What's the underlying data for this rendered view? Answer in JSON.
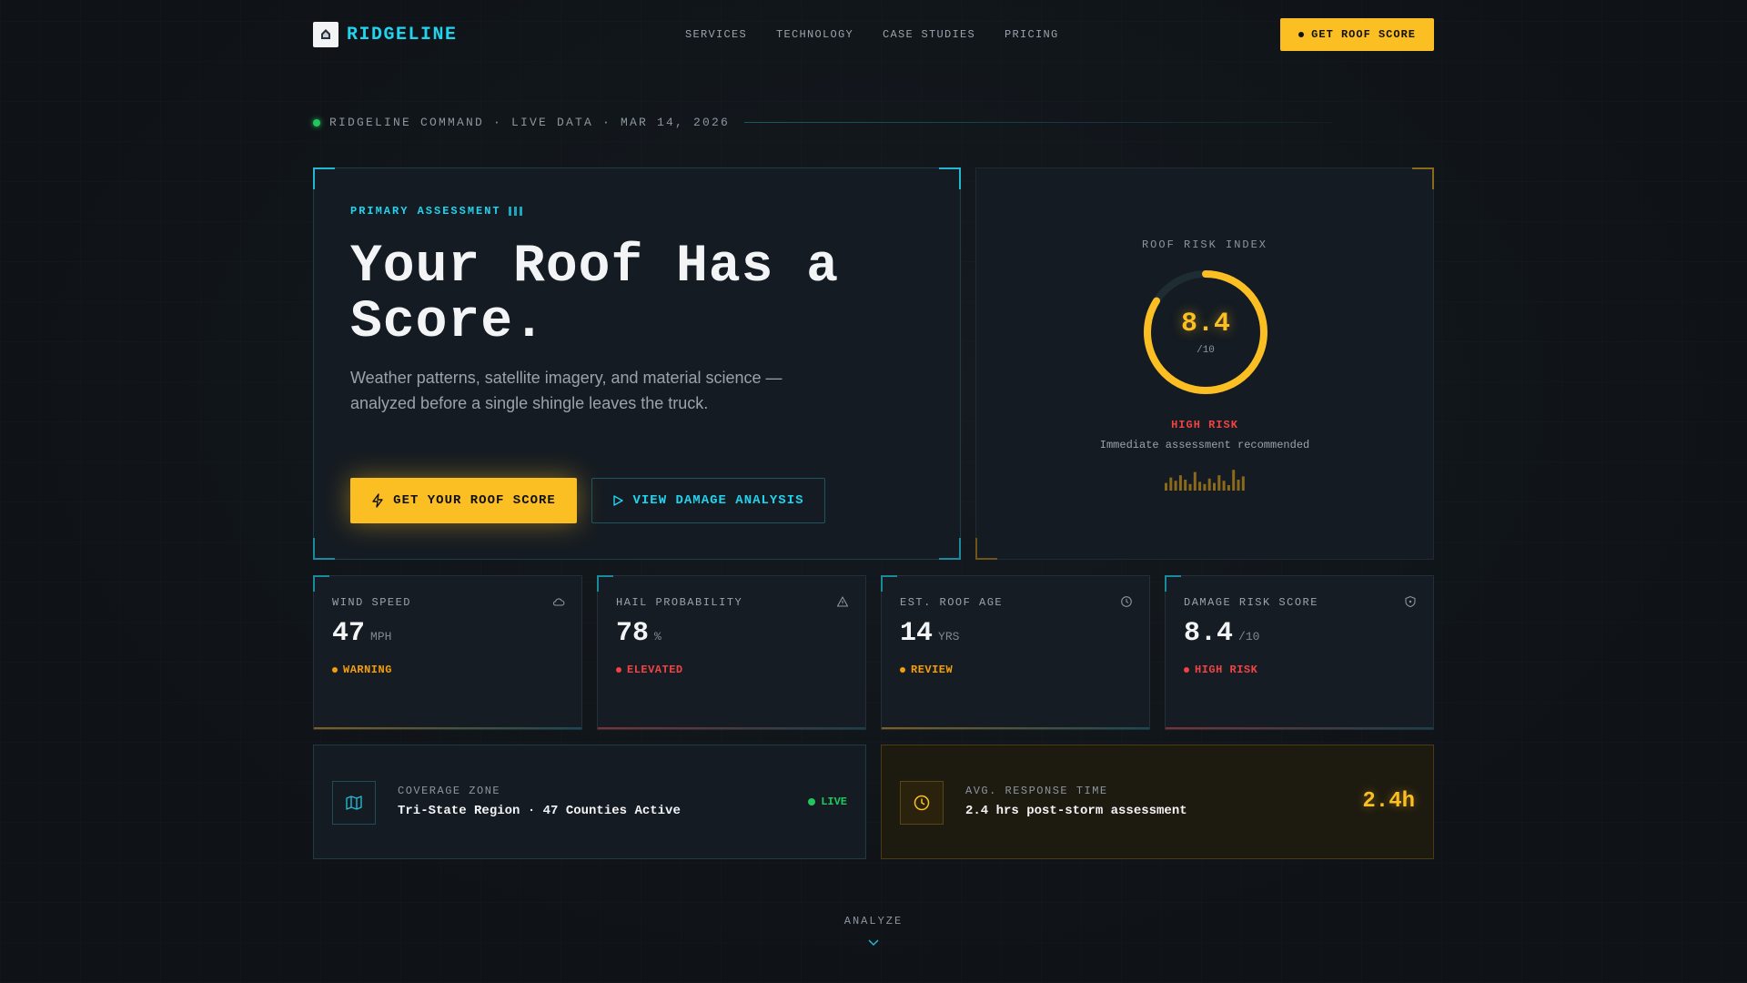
{
  "brand": {
    "name": "RIDGELINE"
  },
  "nav": {
    "links": [
      "SERVICES",
      "TECHNOLOGY",
      "CASE STUDIES",
      "PRICING"
    ],
    "cta": "GET ROOF SCORE"
  },
  "status_line": "RIDGELINE COMMAND · LIVE DATA · MAR 14, 2026",
  "hero": {
    "eyebrow": "PRIMARY ASSESSMENT",
    "headline": "Your Roof Has a Score.",
    "subcopy": "Weather patterns, satellite imagery, and material science — analyzed before a single shingle leaves the truck.",
    "primary_cta": "GET YOUR ROOF SCORE",
    "secondary_cta": "VIEW DAMAGE ANALYSIS"
  },
  "risk_index": {
    "label": "ROOF RISK INDEX",
    "value": "8.4",
    "denominator": "/10",
    "fill_fraction": 0.84,
    "status": "HIGH RISK",
    "note": "Immediate assessment recommended",
    "spark_levels": [
      0.35,
      0.6,
      0.45,
      0.7,
      0.5,
      0.3,
      0.85,
      0.4,
      0.3,
      0.55,
      0.35,
      0.7,
      0.45,
      0.25,
      0.95,
      0.5,
      0.65
    ]
  },
  "metrics": [
    {
      "label": "WIND SPEED",
      "value": "47",
      "unit": "MPH",
      "status": "WARNING",
      "status_color": "#f59e0b",
      "icon": "wind-cloud-icon"
    },
    {
      "label": "HAIL PROBABILITY",
      "value": "78",
      "unit": "%",
      "status": "ELEVATED",
      "status_color": "#ef4444",
      "icon": "alert-triangle-icon"
    },
    {
      "label": "EST. ROOF AGE",
      "value": "14",
      "unit": "YRS",
      "status": "REVIEW",
      "status_color": "#f59e0b",
      "icon": "clock-icon"
    },
    {
      "label": "DAMAGE RISK SCORE",
      "value": "8.4",
      "unit": "/10",
      "status": "HIGH RISK",
      "status_color": "#ef4444",
      "icon": "shield-icon"
    }
  ],
  "coverage": {
    "label": "COVERAGE ZONE",
    "text": "Tri-State Region · 47 Counties Active",
    "badge": "LIVE"
  },
  "response": {
    "label": "AVG. RESPONSE TIME",
    "text": "2.4 hrs post-storm assessment",
    "value": "2.4h"
  },
  "analyze_label": "ANALYZE",
  "colors": {
    "accent_cyan": "#22d3ee",
    "accent_amber": "#fbbf24",
    "danger": "#ef4444",
    "live": "#22c55e"
  }
}
